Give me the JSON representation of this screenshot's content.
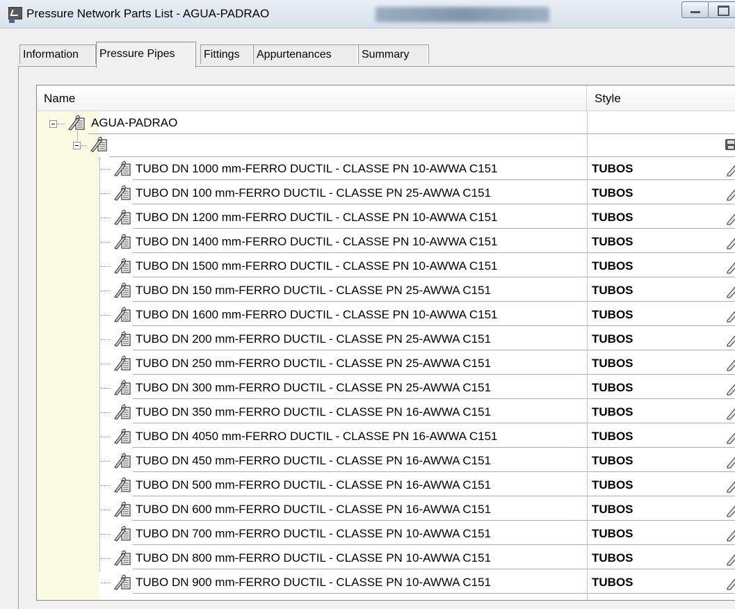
{
  "window": {
    "title": "Pressure Network Parts List - AGUA-PADRAO"
  },
  "tabs": [
    {
      "label": "Information",
      "active": false
    },
    {
      "label": "Pressure Pipes",
      "active": true
    },
    {
      "label": "Fittings",
      "active": false
    },
    {
      "label": "Appurtenances",
      "active": false
    },
    {
      "label": "Summary",
      "active": false
    }
  ],
  "grid": {
    "columns": {
      "name": "Name",
      "style": "Style"
    },
    "root": {
      "label": "AGUA-PADRAO"
    },
    "group": {
      "label": ""
    },
    "rows": [
      {
        "name": "TUBO DN 1000 mm-FERRO DUCTIL - CLASSE PN 10-AWWA C151",
        "style": "TUBOS"
      },
      {
        "name": "TUBO DN 100 mm-FERRO DUCTIL - CLASSE PN 25-AWWA C151",
        "style": "TUBOS"
      },
      {
        "name": "TUBO DN 1200 mm-FERRO DUCTIL - CLASSE PN 10-AWWA C151",
        "style": "TUBOS"
      },
      {
        "name": "TUBO DN 1400 mm-FERRO DUCTIL - CLASSE PN 10-AWWA C151",
        "style": "TUBOS"
      },
      {
        "name": "TUBO DN 1500 mm-FERRO DUCTIL - CLASSE PN 10-AWWA C151",
        "style": "TUBOS"
      },
      {
        "name": "TUBO DN 150 mm-FERRO DUCTIL - CLASSE PN 25-AWWA C151",
        "style": "TUBOS"
      },
      {
        "name": "TUBO DN 1600 mm-FERRO DUCTIL - CLASSE PN 10-AWWA C151",
        "style": "TUBOS"
      },
      {
        "name": "TUBO DN 200 mm-FERRO DUCTIL - CLASSE PN 25-AWWA C151",
        "style": "TUBOS"
      },
      {
        "name": "TUBO DN 250 mm-FERRO DUCTIL - CLASSE PN 25-AWWA C151",
        "style": "TUBOS"
      },
      {
        "name": "TUBO DN 300 mm-FERRO DUCTIL - CLASSE PN 25-AWWA C151",
        "style": "TUBOS"
      },
      {
        "name": "TUBO DN 350 mm-FERRO DUCTIL - CLASSE PN 16-AWWA C151",
        "style": "TUBOS"
      },
      {
        "name": "TUBO DN 4050 mm-FERRO DUCTIL - CLASSE PN 16-AWWA C151",
        "style": "TUBOS"
      },
      {
        "name": "TUBO DN 450 mm-FERRO DUCTIL - CLASSE PN 16-AWWA C151",
        "style": "TUBOS"
      },
      {
        "name": "TUBO DN 500 mm-FERRO DUCTIL - CLASSE PN 16-AWWA C151",
        "style": "TUBOS"
      },
      {
        "name": "TUBO DN 600 mm-FERRO DUCTIL - CLASSE PN 16-AWWA C151",
        "style": "TUBOS"
      },
      {
        "name": "TUBO DN 700 mm-FERRO DUCTIL - CLASSE PN 10-AWWA C151",
        "style": "TUBOS"
      },
      {
        "name": "TUBO DN 800 mm-FERRO DUCTIL - CLASSE PN 10-AWWA C151",
        "style": "TUBOS"
      },
      {
        "name": "TUBO DN 900 mm-FERRO DUCTIL - CLASSE PN 10-AWWA C151",
        "style": "TUBOS"
      }
    ]
  },
  "icons": {
    "app": "autocad-app-icon",
    "pipe": "pipe-catalog-icon",
    "edit": "pencil-edit-icon",
    "save": "floppy-disk-icon"
  }
}
